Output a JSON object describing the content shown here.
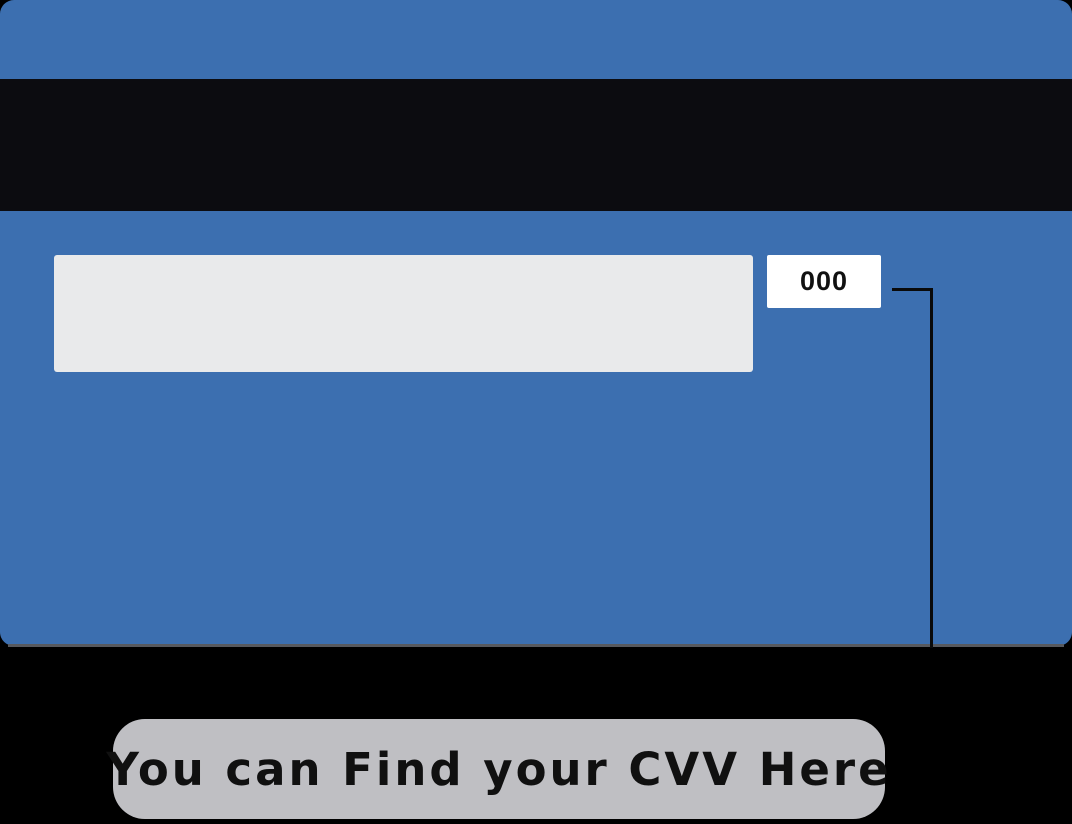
{
  "card": {
    "cvv_value": "000",
    "colors": {
      "card": "#3c6fb0",
      "magnetic_stripe": "#0c0c10",
      "signature_panel": "#e9eaeb",
      "cvv_box": "#ffffff",
      "callout": "#bfbfc3"
    }
  },
  "callout": {
    "text": "You can Find your CVV Here"
  }
}
